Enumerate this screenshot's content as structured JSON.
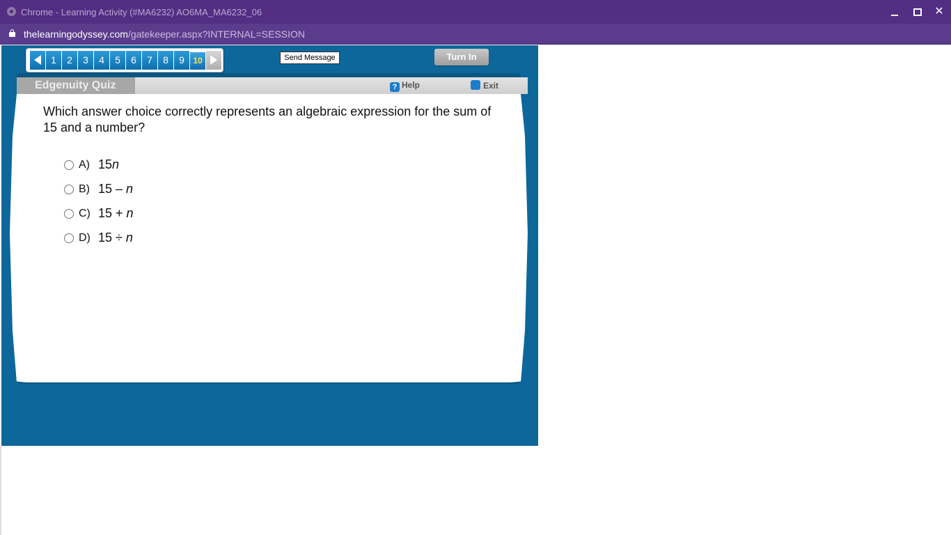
{
  "window": {
    "title": "Chrome - Learning Activity (#MA6232) AO6MA_MA6232_06"
  },
  "urlbar": {
    "host": "thelearningodyssey.com",
    "path": "/gatekeeper.aspx?INTERNAL=SESSION"
  },
  "nav": {
    "questions": [
      "1",
      "2",
      "3",
      "4",
      "5",
      "6",
      "7",
      "8",
      "9",
      "10"
    ],
    "current": "10",
    "send_label": "Send Message",
    "turnin_label": "Turn In"
  },
  "quiz": {
    "header": "Edgenuity Quiz",
    "help_label": "Help",
    "exit_label": "Exit",
    "question": "Which answer choice correctly represents an algebraic expression for the sum of 15 and a number?",
    "options": [
      {
        "letter": "A)",
        "prefix": "15",
        "variable": "n"
      },
      {
        "letter": "B)",
        "prefix": "15 – ",
        "variable": "n"
      },
      {
        "letter": "C)",
        "prefix": "15 + ",
        "variable": "n"
      },
      {
        "letter": "D)",
        "prefix": "15 ÷ ",
        "variable": "n"
      }
    ]
  },
  "colors": {
    "titlebar": "#532e83",
    "app_background": "#0d679b",
    "nav_button": "#1a84c6",
    "current_question": "#ffe14d"
  }
}
